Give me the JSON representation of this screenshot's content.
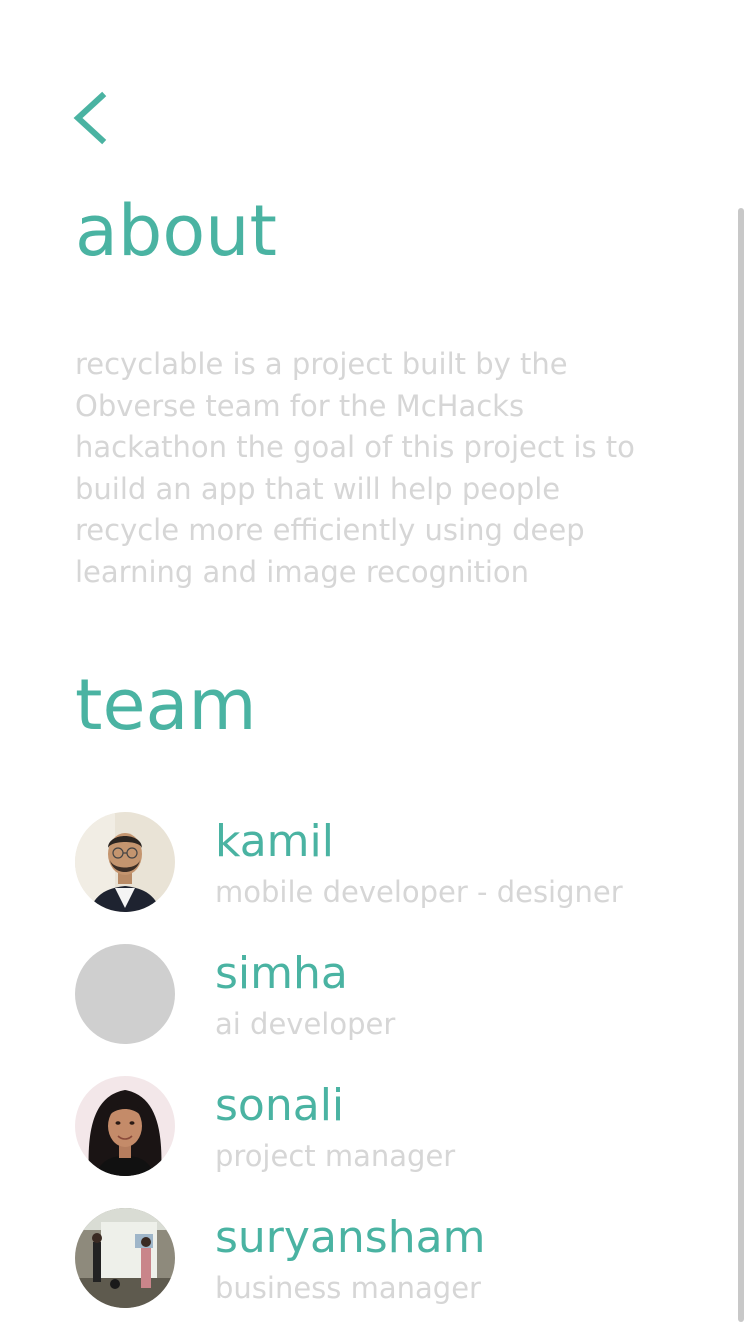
{
  "colors": {
    "accent": "#4AB3A2",
    "muted_text": "#D6D6D6",
    "placeholder_avatar": "#CFCFCF",
    "scrollbar": "#C8C8C8",
    "background": "#FFFFFF"
  },
  "nav": {
    "back_icon": "chevron-left-icon"
  },
  "about": {
    "title": "about",
    "description": "recyclable is a project built by the Obverse team for the McHacks hackathon the goal of this project is to build an app that will help people recycle more efficiently using deep learning and image recognition"
  },
  "team": {
    "title": "team",
    "members": [
      {
        "name": "kamil",
        "role": "mobile developer - designer",
        "avatar": "photo"
      },
      {
        "name": "simha",
        "role": "ai developer",
        "avatar": "placeholder"
      },
      {
        "name": "sonali",
        "role": "project manager",
        "avatar": "photo"
      },
      {
        "name": "suryansham",
        "role": "business manager",
        "avatar": "photo"
      }
    ]
  }
}
